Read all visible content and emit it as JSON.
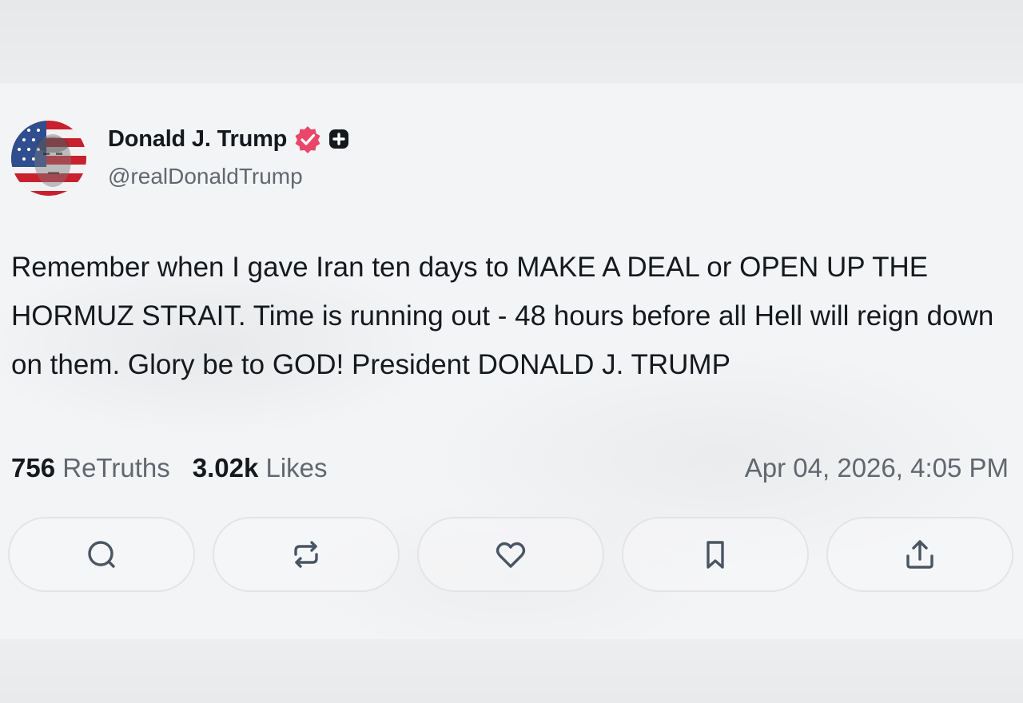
{
  "post": {
    "author": {
      "display_name": "Donald J. Trump",
      "handle": "@realDonaldTrump",
      "verified_icon": "verified-badge-icon",
      "plus_icon": "plus-square-icon"
    },
    "text": "Remember when I gave Iran ten days to MAKE A DEAL or OPEN UP THE HORMUZ STRAIT. Time is running out - 48 hours before all Hell will reign down on them. Glory be to GOD! President DONALD J. TRUMP",
    "stats": {
      "retruths_count": "756",
      "retruths_label": "ReTruths",
      "likes_count": "3.02k",
      "likes_label": "Likes"
    },
    "timestamp": "Apr 04, 2026, 4:05 PM"
  },
  "actions": [
    {
      "name": "reply",
      "icon": "comment-icon"
    },
    {
      "name": "retruth",
      "icon": "repost-icon"
    },
    {
      "name": "like",
      "icon": "heart-icon"
    },
    {
      "name": "bookmark",
      "icon": "bookmark-icon"
    },
    {
      "name": "share",
      "icon": "share-upload-icon"
    }
  ],
  "colors": {
    "text_primary": "#15191e",
    "text_secondary": "#62676f",
    "verified_badge": "#e8476a",
    "icon_stroke": "#4a5563"
  }
}
